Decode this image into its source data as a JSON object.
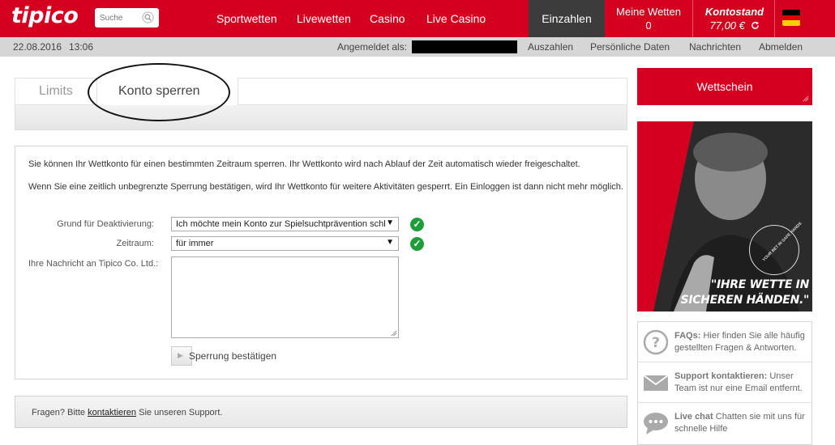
{
  "header": {
    "logo": "tipico",
    "search_placeholder": "Suche",
    "nav": [
      "Sportwetten",
      "Livewetten",
      "Casino",
      "Live Casino"
    ],
    "deposit_label": "Einzahlen",
    "my_bets_label": "Meine Wetten",
    "my_bets_count": "0",
    "balance_label": "Kontostand",
    "balance_value": "77,00 €",
    "language_flag": "germany-flag"
  },
  "subbar": {
    "date": "22.08.2016",
    "time": "13:06",
    "logged_in_label": "Angemeldet als:",
    "links": [
      "Auszahlen",
      "Persönliche Daten",
      "Nachrichten",
      "Abmelden"
    ]
  },
  "tabs": {
    "items": [
      "Limits",
      "Konto sperren"
    ],
    "active": "Konto sperren"
  },
  "form": {
    "intro_1": "Sie können Ihr Wettkonto für einen bestimmten Zeitraum sperren. Ihr Wettkonto wird nach Ablauf der Zeit automatisch wieder freigeschaltet.",
    "intro_2": "Wenn Sie eine zeitlich unbegrenzte Sperrung bestätigen, wird Ihr Wettkonto für weitere Aktivitäten gesperrt. Ein Einloggen ist dann nicht mehr möglich.",
    "reason_label": "Grund für Deaktivierung:",
    "reason_value": "Ich möchte mein Konto zur Spielsuchtprävention schl",
    "period_label": "Zeitraum:",
    "period_value": "für immer",
    "message_label": "Ihre Nachricht an Tipico Co. Ltd.:",
    "message_value": "",
    "confirm_label": "Sperrung bestätigen"
  },
  "support": {
    "prefix": "Fragen? Bitte",
    "link": "kontaktieren",
    "suffix": "Sie unseren Support."
  },
  "sidebar": {
    "betslip_label": "Wettschein",
    "promo_line1": "\"IHRE WETTE IN",
    "promo_line2": "SICHEREN HÄNDEN.\"",
    "promo_seal": "YOUR BET IN SAFE HANDS",
    "help": [
      {
        "icon": "question-icon",
        "title": "FAQs:",
        "text": "Hier finden Sie alle häufig gestellten Fragen & Antworten."
      },
      {
        "icon": "mail-icon",
        "title": "Support kontaktieren:",
        "text": "Unser Team ist nur eine Email entfernt."
      },
      {
        "icon": "chat-icon",
        "title": "Live chat",
        "text": "Chatten sie mit uns für schnelle Hilfe"
      }
    ]
  },
  "colors": {
    "brand_red": "#d3001f",
    "dark": "#3c3c3c",
    "check_green": "#1e9e3a"
  }
}
